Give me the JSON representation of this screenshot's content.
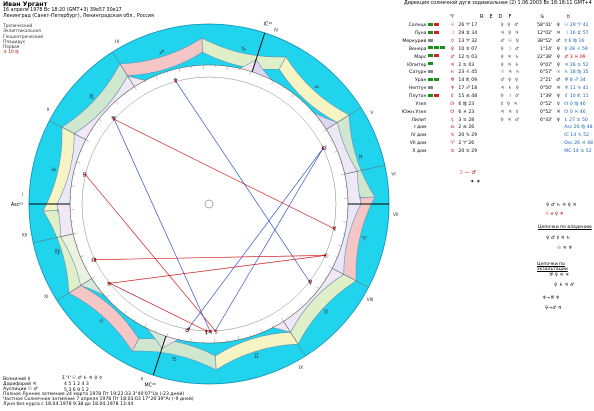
{
  "header": {
    "name": "Иван Ургант",
    "datetime": "16 апреля 1978  Вс  18:20 (GMT+3) 39e57  30e17",
    "place": "Ленинград (Санкт-Петербург), Ленинградская обл., Россия"
  },
  "system": {
    "zodiac": "Тропический",
    "coords": "Эклиптикальная",
    "center": "Геоцентрический",
    "houses": "Плацидус",
    "first_label": "Первая",
    "first_value": "♃  10 ♍"
  },
  "direction": {
    "title": "Дирекция солнечной дуги зодиакальная (2)  1.06.2003  Вс 18:18:11 GMT+4"
  },
  "table_headers": {
    "zodiac_icon": "♈",
    "dignity_letters": [
      "R",
      "E",
      "D",
      "F"
    ],
    "aspect_icon": "♋",
    "right_icon": "♉"
  },
  "planets": [
    {
      "name": "Солнце",
      "bars": [
        "#1a8f1a",
        "#cc2222"
      ],
      "glyph": "☉",
      "sign": "♉",
      "deg": "26 ♈ 17",
      "dig": "♀ ♀ ♂",
      "long": "58°41'",
      "dg": "♀",
      "right": "☉ 20 ♈ 42",
      "rred": false
    },
    {
      "name": "Луна",
      "bars": [
        "#1a8f1a",
        "#cc2222"
      ],
      "glyph": "☽",
      "sign": "♍",
      "deg": "29 ♊ 34",
      "dig": "♃ ♀ ♃",
      "long": "12°02'",
      "dg": "♃",
      "right": "☽ 16 ♊ 57",
      "rred": false
    },
    {
      "name": "Меркурий",
      "bars": [
        "#888888"
      ],
      "glyph": "☿",
      "sign": "♉",
      "deg": "13 ♈ 32",
      "dig": "♂ ☉ ♀",
      "long": "38°52'",
      "dg": "♂",
      "right": "☿ 6 ♍ 16",
      "rred": false
    },
    {
      "name": "Венера",
      "bars": [
        "#1a8f1a",
        "#1a8f1a",
        "#1a8f1a"
      ],
      "glyph": "♀",
      "sign": "♊",
      "deg": "10 ♉ 07",
      "dig": "♀ ☽ ♂",
      "long": "1°14'",
      "dg": "♀",
      "right": "♀ 28 ♌ 59",
      "rred": false
    },
    {
      "name": "Марс",
      "bars": [
        "#1a8f1a",
        "#cc2222"
      ],
      "glyph": "♂",
      "sign": "♋",
      "deg": "12 ♋ 03",
      "dig": "♀ ♃ ♄",
      "long": "22°38'",
      "dg": "♀",
      "right": "♂ 3 ♓ 09",
      "rred": true
    },
    {
      "name": "Юпитер",
      "bars": [
        "#1a8f1a"
      ],
      "glyph": "♃",
      "sign": "♋",
      "deg": "2 ♋ 03",
      "dig": "♀ ♃ ♄",
      "long": "9°07'",
      "dg": "♀",
      "right": "♃ 26 ♋ 52",
      "rred": false
    },
    {
      "name": "Сатурн",
      "bars": [
        "#888888"
      ],
      "glyph": "♄",
      "sign": "♌",
      "deg": "23 ♌ 45",
      "dig": "☉ ♃ ♄",
      "long": "6°57'",
      "dg": "☉",
      "right": "♄ 18 ♍ 35",
      "rred": false
    },
    {
      "name": "Уран",
      "bars": [
        "#1a8f1a",
        "#1a8f1a"
      ],
      "glyph": "♅",
      "sign": "♏",
      "deg": "14 ♏ 09",
      "dig": "♂ ♀ ♀",
      "long": "2°21'",
      "dg": "♂",
      "right": "♅ 8 ♐ 34",
      "rred": false
    },
    {
      "name": "Нептун",
      "bars": [
        "#888888"
      ],
      "glyph": "♆",
      "sign": "♐",
      "deg": "17 ♐ 18",
      "dig": "♃ ♄ ♀",
      "long": "0°50'",
      "dg": "♃",
      "right": "♆ 11 ♑ 41",
      "rred": false
    },
    {
      "name": "Плутон",
      "bars": [
        "#1a8f1a",
        "#cc2222"
      ],
      "glyph": "♇",
      "sign": "♎",
      "deg": "15 ♎ 48",
      "dig": "♀ ☽ ♂",
      "long": "1°39'",
      "dg": "♀",
      "right": "♇ 10 ♏ 11",
      "rred": false
    },
    {
      "name": "Узел",
      "bars": [],
      "glyph": "☊",
      "sign": "♍",
      "deg": "6 ♍ 23",
      "dig": "☿ ♀ ♃",
      "long": "0°52'",
      "dg": "☿",
      "right": "☊ 0 ♍ 46",
      "rred": false
    },
    {
      "name": "Южн.Узел",
      "bars": [],
      "glyph": "☋",
      "sign": "♓",
      "deg": "6 ♓ 23",
      "dig": "♃ ♃ ☿",
      "long": "0°52'",
      "dg": "♃",
      "right": "☋ 0 ♓ 46",
      "rred": false
    },
    {
      "name": "Лилит",
      "bars": [],
      "glyph": "⚸",
      "sign": "♋",
      "deg": "3 ♋ 28",
      "dig": "♀ ♃ ♂",
      "long": "6°43'",
      "dg": "♀",
      "right": "⚸ 27 ♋ 50",
      "rred": false
    }
  ],
  "houses": [
    {
      "name": "I дом",
      "sign": "♎",
      "deg": "2 ♎ 26",
      "right": "Asc 26 ♍ 48"
    },
    {
      "name": "IV дом",
      "sign": "♑",
      "deg": "20 ♑ 29",
      "right": "IC 14 ♑ 52"
    },
    {
      "name": "VII дом",
      "sign": "♈",
      "deg": "2 ♈ 26",
      "right": "Dsc 26 ♓ 48"
    },
    {
      "name": "X дом",
      "sign": "♋",
      "deg": "20 ♋ 29",
      "right": "MC 14 ♋ 52"
    }
  ],
  "signs": [
    "♈",
    "♉",
    "♊",
    "♋",
    "♌",
    "♍",
    "♎",
    "♏",
    "♐",
    "♑",
    "♒",
    "♓"
  ],
  "sign_colors": [
    "#f5c6c6",
    "#dff0c8",
    "#f6f4c2",
    "#cfe6cf",
    "#f5c6c6",
    "#dff0c8",
    "#f6f4c2",
    "#cfe6cf",
    "#f5c6c6",
    "#dff0c8",
    "#f6f4c2",
    "#cfe6cf"
  ],
  "chart_labels": {
    "asc": "Asc⁰³",
    "mc": "MC¹⁵",
    "dsc": "Dsc",
    "ic": "IC¹⁵",
    "house_numbers": [
      "I",
      "II",
      "III",
      "IV",
      "V",
      "VI",
      "VII",
      "VIII",
      "IX",
      "X",
      "XI",
      "XII"
    ]
  },
  "right_sections": {
    "owners_title": "Цепочки по владению",
    "exalt_title": "Цепочки по экзальтации",
    "owners_glyphs": "♀ ♂ ☿ ♃ ♄",
    "owners_glyphs2": "☉ ♃ ♆",
    "exalt_glyphs": "♅ ♀ ♃ ♃",
    "exalt_glyphs2": "♀ ♄ ♃ ♂",
    "aspect_cluster": "♀ ♂ ♄ ♃ ♀ ♃",
    "line1": "♆→♅  ♆",
    "line2": "♀→♂ ♃"
  },
  "bottom": {
    "line1": "Возничий  ☿",
    "line2": "Дорифорий  ♃",
    "line3": "Ауспиции  ☉ ♂",
    "line4": "Полное Лунное затмение 24 марта 1978 Пт 19:22:33  3°40'07\"Lb (-23 дней)",
    "line5": "Частное Солнечное затмение 7 апреля 1978 Пт 18:03:03  17°26'39\"Ar (-9 дней)",
    "line6": "Луна без курса с 18.04.1978  9:38 до 18.04.1978 13:44",
    "stats_row1": "Σ ♈ ☉ ♂ ♄ ♃ ♀ ☿",
    "stats_row2": "4  5  1  2  4  3  ",
    "stats_row3": "5  3  6  9  1  2"
  }
}
